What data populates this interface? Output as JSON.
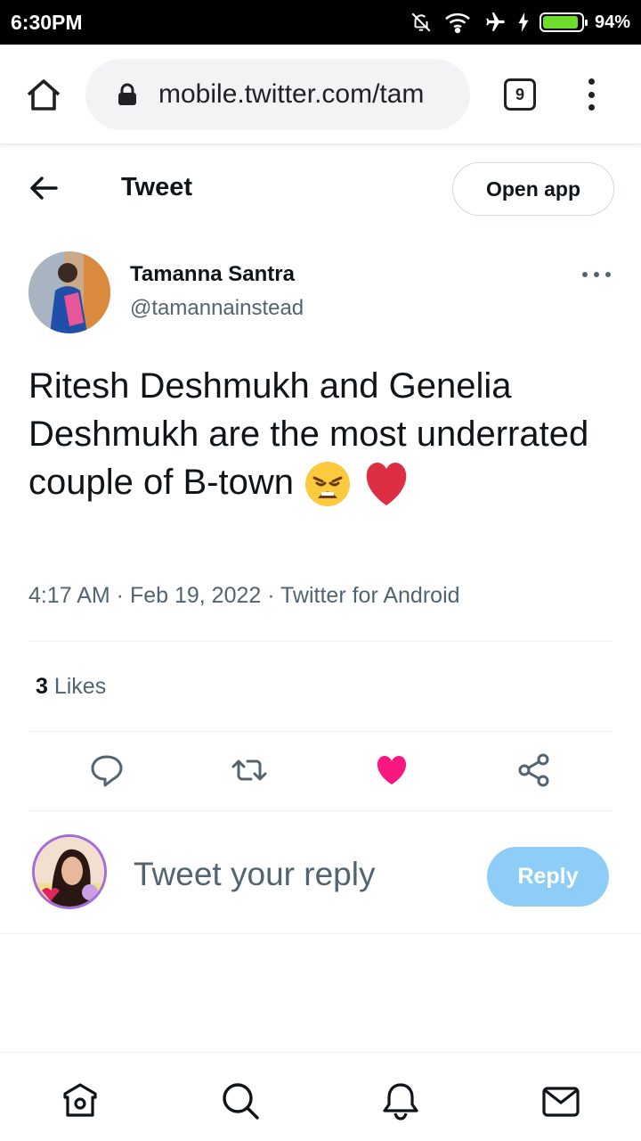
{
  "status_bar": {
    "time": "6:30PM",
    "battery_percent": "94%",
    "battery_level": 0.94,
    "icons": [
      "mute-icon",
      "wifi-icon",
      "airplane-icon",
      "charging-icon",
      "battery-icon"
    ]
  },
  "browser": {
    "url": "mobile.twitter.com/tam",
    "tab_count": "9"
  },
  "header": {
    "title": "Tweet",
    "open_app_label": "Open app"
  },
  "tweet": {
    "author_name": "Tamanna Santra",
    "author_handle": "@tamannainstead",
    "text": "Ritesh Deshmukh and Genelia Deshmukh are the most underrated couple of B-town",
    "timestamp": "4:17 AM · Feb 19, 2022 · Twitter for Android",
    "likes_count": "3",
    "likes_label": " Likes",
    "liked": true
  },
  "reply": {
    "placeholder": "Tweet your reply",
    "button_label": "Reply"
  },
  "colors": {
    "like_active": "#f91880",
    "reply_button": "#8ecdf8",
    "secondary_text": "#536471"
  },
  "bottom_nav": [
    "home-icon",
    "search-icon",
    "notifications-icon",
    "messages-icon"
  ]
}
